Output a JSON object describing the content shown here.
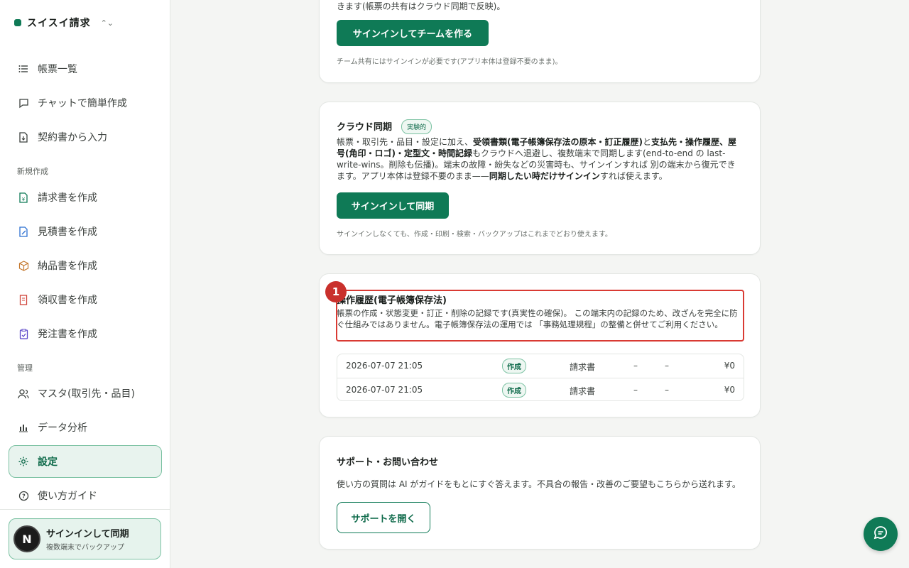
{
  "brand": {
    "name": "スイスイ請求",
    "chevron": "⌃⌄"
  },
  "sidebar": {
    "top_items": [
      {
        "label": "帳票一覧",
        "icon": "list-icon"
      },
      {
        "label": "チャットで簡単作成",
        "icon": "chat-icon"
      },
      {
        "label": "契約書から入力",
        "icon": "file-import-icon"
      }
    ],
    "section_create": "新規作成",
    "create_items": [
      {
        "label": "請求書を作成",
        "icon": "invoice-icon"
      },
      {
        "label": "見積書を作成",
        "icon": "estimate-icon"
      },
      {
        "label": "納品書を作成",
        "icon": "box-icon"
      },
      {
        "label": "領収書を作成",
        "icon": "receipt-icon"
      },
      {
        "label": "発注書を作成",
        "icon": "order-icon"
      }
    ],
    "section_admin": "管理",
    "admin_items": [
      {
        "label": "マスタ(取引先・品目)",
        "icon": "users-icon"
      },
      {
        "label": "データ分析",
        "icon": "bar-chart-icon"
      },
      {
        "label": "設定",
        "icon": "gear-icon",
        "active": true
      },
      {
        "label": "使い方ガイド",
        "icon": "help-icon"
      }
    ],
    "signin": {
      "avatar": "N",
      "title": "サインインして同期",
      "subtitle": "複数端末でバックアップ"
    }
  },
  "team_card": {
    "intro_tail": "きます(帳票の共有はクラウド同期で反映)。",
    "button": "サインインしてチームを作る",
    "note": "チーム共有にはサインインが必要です(アプリ本体は登録不要のまま)。"
  },
  "cloud_card": {
    "title": "クラウド同期",
    "badge": "実験的",
    "desc_1": "帳票・取引先・品目・設定に加え、",
    "desc_b1": "受領書類(電子帳簿保存法の原本・訂正履歴)",
    "desc_2": "と",
    "desc_b2": "支払先・操作履歴、屋号(角印・ロゴ)・定型文・時間記録",
    "desc_3": "もクラウドへ退避し、複数端末で同期します(end-to-end の last-write-wins。削除も伝播)。端末の故障・紛失などの災害時も、サインインすれば 別の端末から復元できます。アプリ本体は登録不要のまま——",
    "desc_b3": "同期したい時だけサインイン",
    "desc_4": "すれば使えます。",
    "button": "サインインして同期",
    "note": "サインインしなくても、作成・印刷・検索・バックアップはこれまでどおり使えます。"
  },
  "history_card": {
    "title": "操作履歴(電子帳簿保存法)",
    "desc": "帳票の作成・状態変更・訂正・削除の記録です(真実性の確保)。 この端末内の記録のため、改ざんを完全に防ぐ仕組みではありません。電子帳簿保存法の運用では 「事務処理規程」の整備と併せてご利用ください。",
    "rows": [
      {
        "datetime": "2026-07-07 21:05",
        "action": "作成",
        "doc": "請求書",
        "c1": "–",
        "c2": "–",
        "amount": "¥0"
      },
      {
        "datetime": "2026-07-07 21:05",
        "action": "作成",
        "doc": "請求書",
        "c1": "–",
        "c2": "–",
        "amount": "¥0"
      }
    ]
  },
  "support_card": {
    "title": "サポート・お問い合わせ",
    "desc": "使い方の質問は AI がガイドをもとにすぐ答えます。不具合の報告・改善のご要望もこちらから送れます。",
    "button": "サポートを開く"
  },
  "annotation": {
    "marker": "1"
  },
  "colors": {
    "accent": "#0f7a56",
    "highlight": "#d93a33"
  }
}
